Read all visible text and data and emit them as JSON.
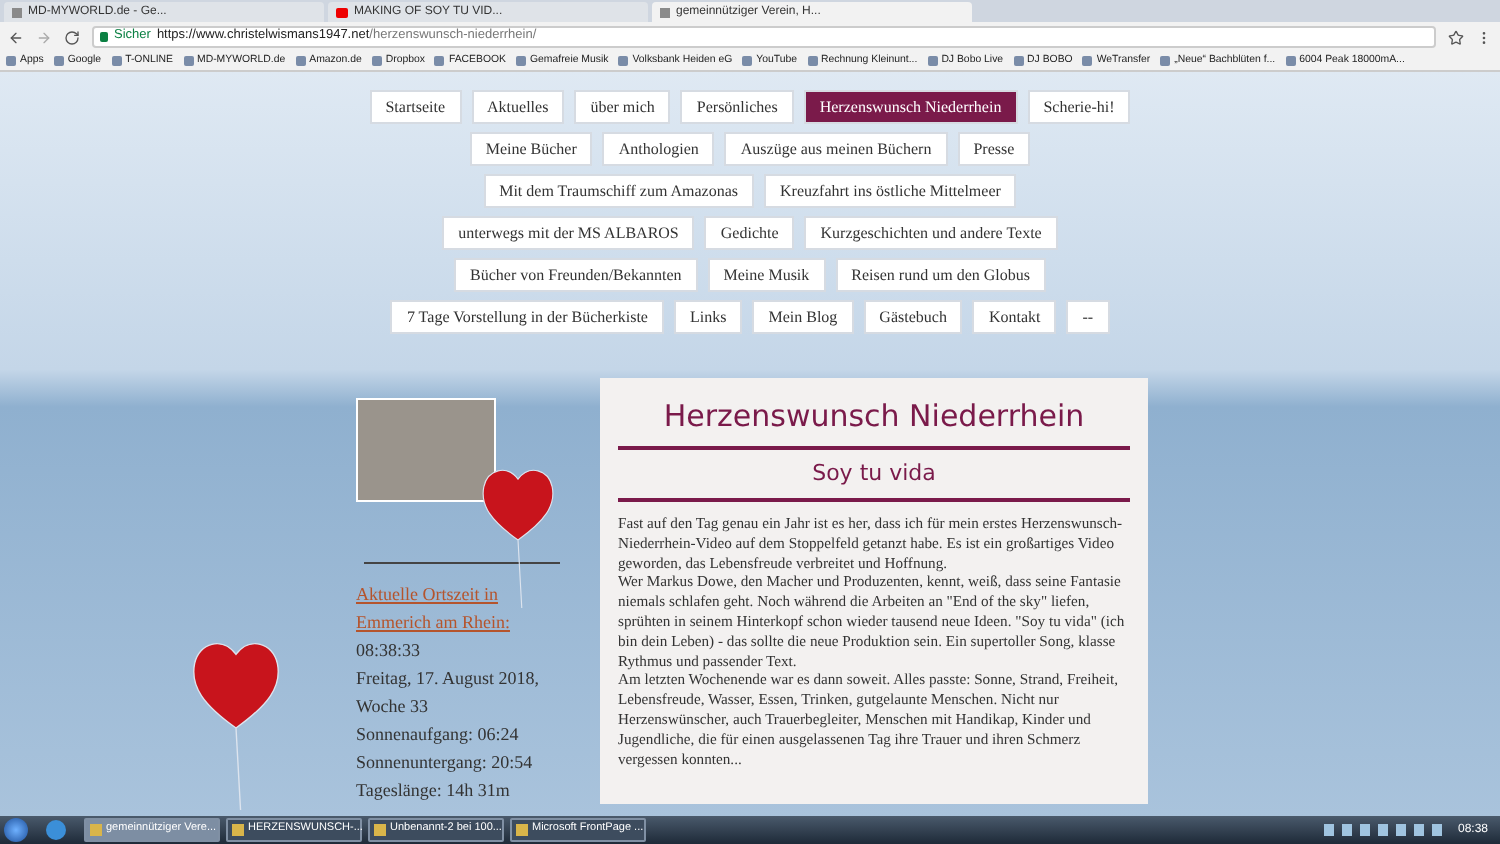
{
  "browser": {
    "tabs": [
      {
        "title": "MD-MYWORLD.de - Ge...",
        "selected": false,
        "kind": "page"
      },
      {
        "title": "MAKING OF SOY TU VID...",
        "selected": false,
        "kind": "video"
      },
      {
        "title": "gemeinnütziger Verein, H...",
        "selected": true,
        "kind": "page"
      }
    ],
    "security_label": "Sicher",
    "url_host": "https://www.christelwismans1947.net",
    "url_path": "/herzenswunsch-niederrhein/",
    "bookmarks": [
      "Apps",
      "Google",
      "T-ONLINE",
      "MD-MYWORLD.de",
      "Amazon.de",
      "Dropbox",
      "FACEBOOK",
      "Gemafreie Musik",
      "Volksbank Heiden eG",
      "YouTube",
      "Rechnung Kleinunt...",
      "DJ Bobo Live",
      "DJ BOBO",
      "WeTransfer",
      "„Neue“ Bachblüten f...",
      "6004 Peak 18000mA..."
    ]
  },
  "nav_rows": [
    [
      {
        "label": "Startseite",
        "selected": false
      },
      {
        "label": "Aktuelles",
        "selected": false
      },
      {
        "label": "über mich",
        "selected": false
      },
      {
        "label": "Persönliches",
        "selected": false
      },
      {
        "label": "Herzenswunsch Niederrhein",
        "selected": true
      },
      {
        "label": "Scherie-hi!",
        "selected": false
      }
    ],
    [
      {
        "label": "Meine Bücher",
        "selected": false
      },
      {
        "label": "Anthologien",
        "selected": false
      },
      {
        "label": "Auszüge aus meinen Büchern",
        "selected": false
      },
      {
        "label": "Presse",
        "selected": false
      }
    ],
    [
      {
        "label": "Mit dem Traumschiff zum Amazonas",
        "selected": false
      },
      {
        "label": "Kreuzfahrt ins östliche Mittelmeer",
        "selected": false
      }
    ],
    [
      {
        "label": "unterwegs mit der MS ALBAROS",
        "selected": false
      },
      {
        "label": "Gedichte",
        "selected": false
      },
      {
        "label": "Kurzgeschichten und andere Texte",
        "selected": false
      }
    ],
    [
      {
        "label": "Bücher von Freunden/Bekannten",
        "selected": false
      },
      {
        "label": "Meine Musik",
        "selected": false
      },
      {
        "label": "Reisen rund um den Globus",
        "selected": false
      }
    ],
    [
      {
        "label": "7 Tage Vorstellung in der Bücherkiste",
        "selected": false
      },
      {
        "label": "Links",
        "selected": false
      },
      {
        "label": "Mein Blog",
        "selected": false
      },
      {
        "label": "Gästebuch",
        "selected": false
      },
      {
        "label": "Kontakt",
        "selected": false
      },
      {
        "label": "--",
        "selected": false
      }
    ]
  ],
  "sidebar": {
    "clock_link": "Aktuelle Ortszeit in Emmerich am Rhein:",
    "lines": [
      "08:38:33",
      "Freitag, 17. August 2018,",
      "Woche 33",
      "Sonnenaufgang: 06:24",
      "Sonnenuntergang: 20:54",
      "Tageslänge: 14h 31m"
    ]
  },
  "content": {
    "title": "Herzenswunsch Niederrhein",
    "subtitle": "Soy tu vida",
    "paragraphs": [
      "Fast auf den Tag genau ein Jahr ist es her, dass ich für mein erstes Herzenswunsch-Niederrhein-Video auf dem Stoppelfeld getanzt habe. Es ist ein großartiges Video geworden, das Lebensfreude verbreitet und Hoffnung.",
      "Wer Markus Dowe, den Macher und Produzenten, kennt, weiß, dass seine Fantasie niemals schlafen geht. Noch während die Arbeiten an \"End of the sky\" liefen, sprühten in seinem Hinterkopf schon wieder tausend neue Ideen. \"Soy tu vida\" (ich bin dein Leben) - das sollte die neue Produktion sein. Ein supertoller Song, klasse Rythmus und passender Text.",
      "Am letzten Wochenende war es dann soweit. Alles passte: Sonne, Strand, Freiheit, Lebensfreude, Wasser, Essen, Trinken, gutgelaunte Menschen. Nicht nur Herzenswünscher, auch Trauerbegleiter, Menschen mit Handikap, Kinder und Jugendliche, die für einen ausgelassenen Tag ihre Trauer und ihren Schmerz vergessen konnten..."
    ]
  },
  "taskbar": {
    "buttons": [
      {
        "label": "gemeinnütziger Vere...",
        "selected": true
      },
      {
        "label": "HERZENSWUNSCH-...",
        "selected": false
      },
      {
        "label": "Unbenannt-2 bei 100...",
        "selected": false
      },
      {
        "label": "Microsoft FrontPage ...",
        "selected": false
      }
    ],
    "clock": "08:38"
  }
}
